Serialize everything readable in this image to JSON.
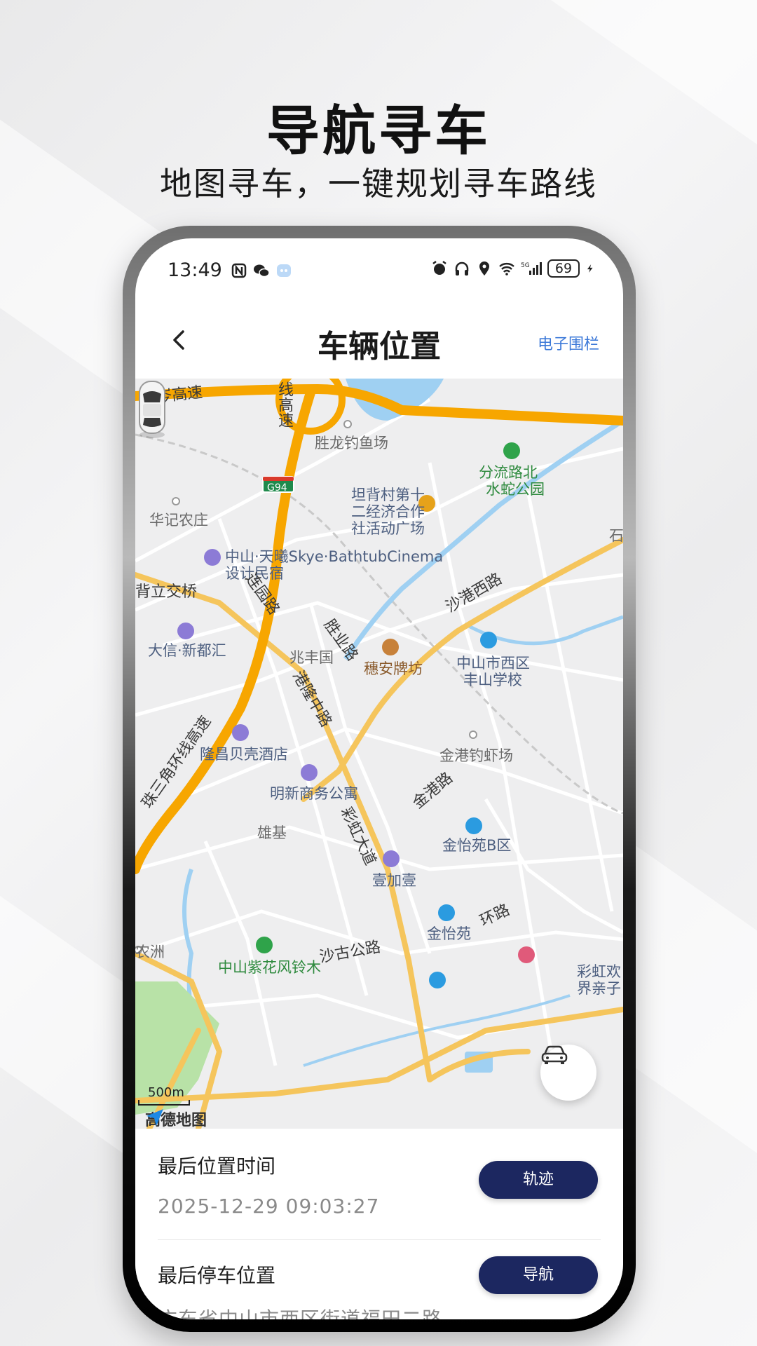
{
  "promo": {
    "title": "导航寻车",
    "subtitle": "地图寻车，一键规划寻车路线"
  },
  "status_bar": {
    "time": "13:49",
    "battery": "69",
    "network": "5G"
  },
  "nav": {
    "title": "车辆位置",
    "right_link": "电子围栏"
  },
  "map": {
    "provider": "高德地图",
    "scale": "500m",
    "labels": [
      {
        "text": "深岑高速",
        "kind": "road"
      },
      {
        "text": "线高速",
        "kind": "road"
      },
      {
        "text": "胜龙钓鱼场",
        "kind": "plain"
      },
      {
        "text": "分流路北",
        "kind": "green"
      },
      {
        "text": "水蛇公园",
        "kind": "green"
      },
      {
        "text": "G94",
        "kind": "shield"
      },
      {
        "text": "坦背村第十",
        "kind": "poi"
      },
      {
        "text": "二经济合作",
        "kind": "poi"
      },
      {
        "text": "社活动广场",
        "kind": "poi"
      },
      {
        "text": "华记农庄",
        "kind": "plain"
      },
      {
        "text": "石",
        "kind": "plain"
      },
      {
        "text": "中山·天曦Skye·BathtubCinema",
        "kind": "poi"
      },
      {
        "text": "设计民宿",
        "kind": "poi"
      },
      {
        "text": "背立交桥",
        "kind": "road"
      },
      {
        "text": "沙港西路",
        "kind": "road"
      },
      {
        "text": "连园路",
        "kind": "road"
      },
      {
        "text": "胜业路",
        "kind": "road"
      },
      {
        "text": "大信·新都汇",
        "kind": "poi"
      },
      {
        "text": "兆丰国",
        "kind": "plain"
      },
      {
        "text": "穗安牌坊",
        "kind": "brown"
      },
      {
        "text": "中山市西区",
        "kind": "poi"
      },
      {
        "text": "丰山学校",
        "kind": "poi"
      },
      {
        "text": "港隆中路",
        "kind": "road"
      },
      {
        "text": "珠三角环线高速",
        "kind": "road"
      },
      {
        "text": "隆昌贝壳酒店",
        "kind": "poi"
      },
      {
        "text": "金港钓虾场",
        "kind": "plain"
      },
      {
        "text": "明新商务公寓",
        "kind": "poi"
      },
      {
        "text": "金港路",
        "kind": "road"
      },
      {
        "text": "彩虹大道",
        "kind": "road"
      },
      {
        "text": "雄基",
        "kind": "plain"
      },
      {
        "text": "金怡苑B区",
        "kind": "poi"
      },
      {
        "text": "壹加壹",
        "kind": "poi"
      },
      {
        "text": "金怡苑",
        "kind": "poi"
      },
      {
        "text": "环路",
        "kind": "road"
      },
      {
        "text": "农洲",
        "kind": "plain"
      },
      {
        "text": "中山紫花风铃木",
        "kind": "green"
      },
      {
        "text": "沙古公路",
        "kind": "road"
      },
      {
        "text": "彩虹欢",
        "kind": "poi"
      },
      {
        "text": "界亲子",
        "kind": "poi"
      }
    ]
  },
  "info": {
    "last_time_label": "最后位置时间",
    "last_time_value": "2025-12-29 09:03:27",
    "track_button": "轨迹",
    "last_parking_label": "最后停车位置",
    "last_parking_value": "广东省中山市西区街道福田二路",
    "navigate_button": "导航"
  },
  "colors": {
    "accent_link": "#3b78d8",
    "button_bg": "#1c2760",
    "highway": "#f7a600",
    "secondary_road": "#f5c55c",
    "water": "#9fd0f2"
  }
}
